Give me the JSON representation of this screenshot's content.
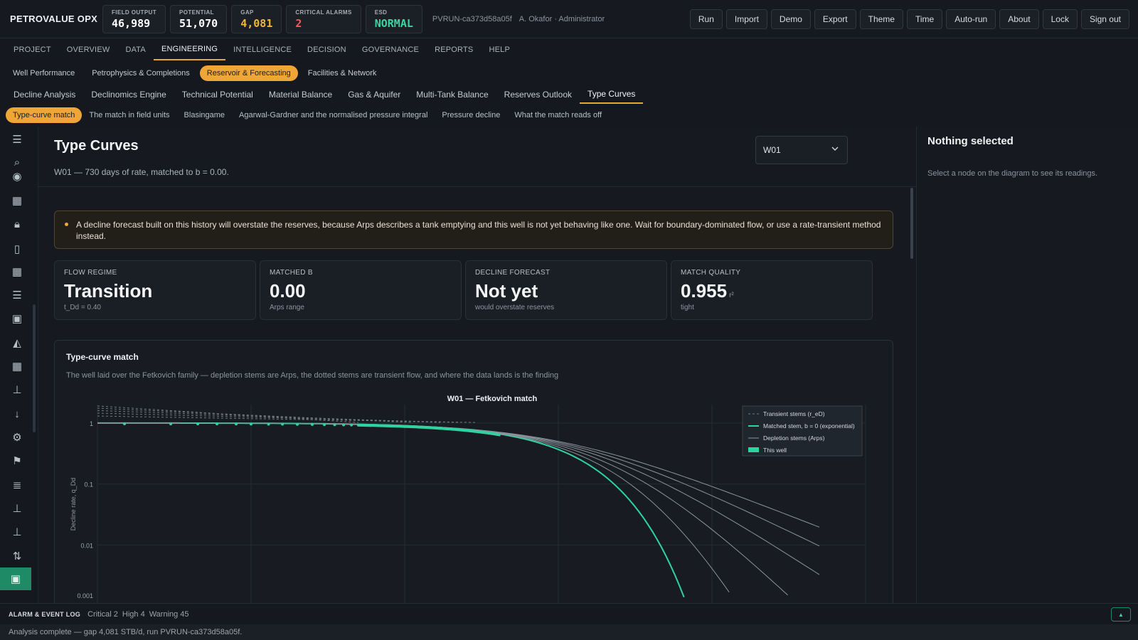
{
  "brand": "PETROVALUE OPX",
  "kpis": [
    {
      "label": "FIELD OUTPUT",
      "value": "46,989",
      "color": "#ffffff"
    },
    {
      "label": "POTENTIAL",
      "value": "51,070",
      "color": "#ffffff"
    },
    {
      "label": "GAP",
      "value": "4,081",
      "color": "#f0b63c"
    },
    {
      "label": "CRITICAL ALARMS",
      "value": "2",
      "color": "#ef5a5a"
    },
    {
      "label": "ESD",
      "value": "NORMAL",
      "color": "#3fd3a0"
    }
  ],
  "run_id": "PVRUN-ca373d58a05f",
  "user": "A. Okafor · Administrator",
  "actions": [
    "Run",
    "Import",
    "Demo",
    "Export",
    "Theme",
    "Time",
    "Auto-run",
    "About",
    "Lock",
    "Sign out"
  ],
  "nav_main": [
    "PROJECT",
    "OVERVIEW",
    "DATA",
    "ENGINEERING",
    "INTELLIGENCE",
    "DECISION",
    "GOVERNANCE",
    "REPORTS",
    "HELP"
  ],
  "nav_main_active": "ENGINEERING",
  "nav_sub": [
    "Well Performance",
    "Petrophysics & Completions",
    "Reservoir & Forecasting",
    "Facilities & Network"
  ],
  "nav_sub_active": "Reservoir & Forecasting",
  "nav_tabs": [
    "Decline Analysis",
    "Declinomics Engine",
    "Technical Potential",
    "Material Balance",
    "Gas & Aquifer",
    "Multi-Tank Balance",
    "Reserves Outlook",
    "Type Curves"
  ],
  "nav_tabs_active": "Type Curves",
  "nav_sections": [
    "Type-curve match",
    "The match in field units",
    "Blasingame",
    "Agarwal-Gardner and the normalised pressure integral",
    "Pressure decline",
    "What the match reads off"
  ],
  "nav_sections_active": "Type-curve match",
  "rail_icons": [
    "menu-icon",
    "search-icon",
    "target-icon",
    "grid-icon",
    "lock-icon",
    "phone-icon",
    "table-icon",
    "checklist-icon",
    "image-icon",
    "area-chart-icon",
    "grid-icon",
    "thermometer-icon",
    "arrow-down-icon",
    "gears-icon",
    "flag-icon",
    "list-icon",
    "thermometer-icon",
    "thermometer-icon",
    "swap-icon",
    "chart-image-icon"
  ],
  "page": {
    "title": "Type Curves",
    "subtitle": "W01 — 730 days of rate, matched to b = 0.00.",
    "well_select": "W01"
  },
  "warning": "A decline forecast built on this history will overstate the reserves, because Arps describes a tank emptying and this well is not yet behaving like one. Wait for boundary-dominated flow, or use a rate-transient method instead.",
  "cards": [
    {
      "label": "FLOW REGIME",
      "value": "Transition",
      "unit": "",
      "note": "t_Dd = 0.40"
    },
    {
      "label": "MATCHED B",
      "value": "0.00",
      "unit": "",
      "note": "Arps range"
    },
    {
      "label": "DECLINE FORECAST",
      "value": "Not yet",
      "unit": "",
      "note": "would overstate reserves"
    },
    {
      "label": "MATCH QUALITY",
      "value": "0.955",
      "unit": "r²",
      "note": "tight"
    }
  ],
  "chart_panel": {
    "title": "Type-curve match",
    "subtitle": "The well laid over the Fetkovich family — depletion stems are Arps, the dotted stems are transient flow, and where the data lands is the finding"
  },
  "chart_data": {
    "type": "line",
    "title": "W01 — Fetkovich match",
    "xlabel": "",
    "ylabel": "Decline rate, q_Dd",
    "y_scale": "log",
    "x_scale": "log",
    "ylim": [
      0.001,
      2
    ],
    "xlim": [
      0.001,
      100
    ],
    "y_ticks": [
      "1",
      "0.1",
      "0.01",
      "0.001"
    ],
    "grid": true,
    "legend_position": "top-right",
    "legend": [
      "Transient stems (r_eD)",
      "Matched stem, b = 0 (exponential)",
      "Depletion stems (Arps)",
      "This well"
    ],
    "depletion_b_values": [
      0,
      0.2,
      0.4,
      0.6,
      0.8,
      1.0
    ],
    "matched_b": 0,
    "transient_stems": 5,
    "well_points_x": [
      0.0015,
      0.003,
      0.0045,
      0.006,
      0.008,
      0.01,
      0.013,
      0.016,
      0.02,
      0.025,
      0.03,
      0.035,
      0.04,
      0.045,
      0.05,
      0.055,
      0.06,
      0.07,
      0.08,
      0.1,
      0.13,
      0.17,
      0.22,
      0.3,
      0.4
    ],
    "colors": {
      "matched": "#2fd3a0",
      "depletion": "#8a939d",
      "transient": "#6f7882",
      "well": "#2fd3a0"
    }
  },
  "side_panel": {
    "title": "Nothing selected",
    "subtitle": "Select a node on the diagram to see its readings."
  },
  "alarm_bar": {
    "label": "ALARM & EVENT LOG",
    "items": [
      "Critical 2",
      "High 4",
      "Warning 45"
    ]
  },
  "status": "Analysis complete — gap 4,081 STB/d, run PVRUN-ca373d58a05f."
}
